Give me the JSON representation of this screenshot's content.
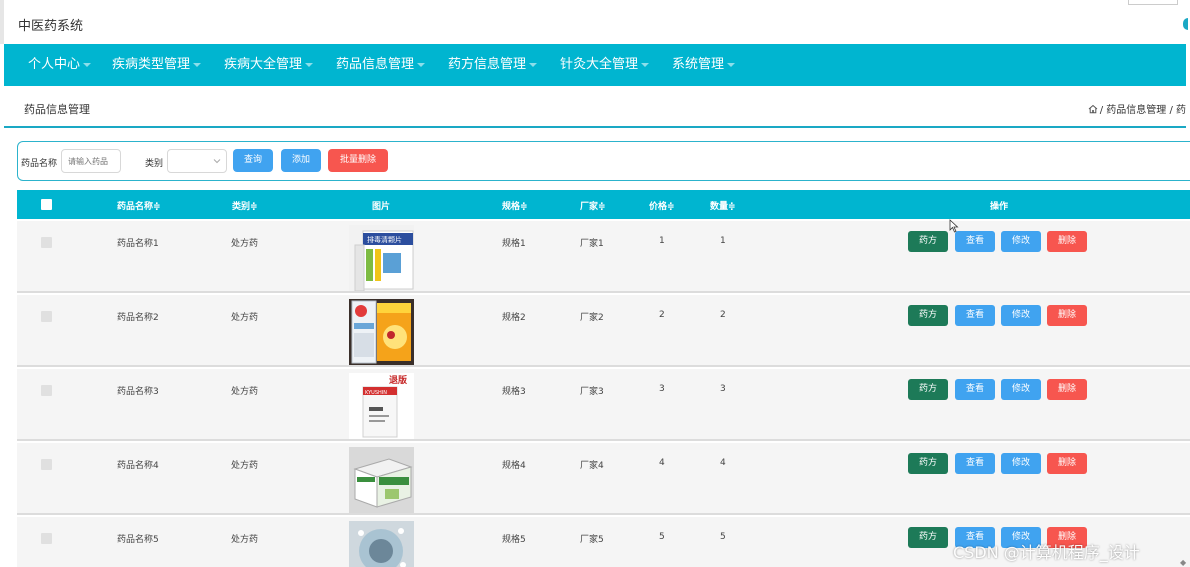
{
  "app": {
    "title": "中医药系统"
  },
  "nav": {
    "items": [
      "个人中心",
      "疾病类型管理",
      "疾病大全管理",
      "药品信息管理",
      "药方信息管理",
      "针灸大全管理",
      "系统管理"
    ]
  },
  "breadcrumb": {
    "page_title": "药品信息管理",
    "trail": "/ 药品信息管理 / 药"
  },
  "filters": {
    "name_label": "药品名称",
    "name_placeholder": "请输入药品",
    "category_label": "类别",
    "category_value": "",
    "query_button": "查询",
    "add_button": "添加",
    "batch_delete_button": "批量删除"
  },
  "table": {
    "headers": {
      "name": "药品名称≑",
      "category": "类别≑",
      "image": "图片",
      "spec": "规格≑",
      "maker": "厂家≑",
      "price": "价格≑",
      "qty": "数量≑",
      "actions": "操作"
    },
    "rows": [
      {
        "name": "药品名称1",
        "category": "处方药",
        "spec": "规格1",
        "maker": "厂家1",
        "price": "1",
        "qty": "1",
        "image_icon": "medicine-box-image-1"
      },
      {
        "name": "药品名称2",
        "category": "处方药",
        "spec": "规格2",
        "maker": "厂家2",
        "price": "2",
        "qty": "2",
        "image_icon": "medicine-box-image-2"
      },
      {
        "name": "药品名称3",
        "category": "处方药",
        "spec": "规格3",
        "maker": "厂家3",
        "price": "3",
        "qty": "3",
        "image_icon": "medicine-box-image-3"
      },
      {
        "name": "药品名称4",
        "category": "处方药",
        "spec": "规格4",
        "maker": "厂家4",
        "price": "4",
        "qty": "4",
        "image_icon": "medicine-box-image-4"
      },
      {
        "name": "药品名称5",
        "category": "处方药",
        "spec": "规格5",
        "maker": "厂家5",
        "price": "5",
        "qty": "5",
        "image_icon": "medicine-box-image-5"
      }
    ],
    "row_actions": {
      "prescription": "药方",
      "view": "查看",
      "edit": "修改",
      "delete": "删除"
    },
    "product_labels": {
      "row1": "排毒清颗片",
      "row3_tag": "退版",
      "row3_brand": "KYUSHIN"
    }
  },
  "watermark": "CSDN @计算机程序_设计",
  "colors": {
    "nav": "#00b5d0",
    "primary": "#40a3f0",
    "danger": "#f7564f",
    "success": "#1d7a58"
  }
}
